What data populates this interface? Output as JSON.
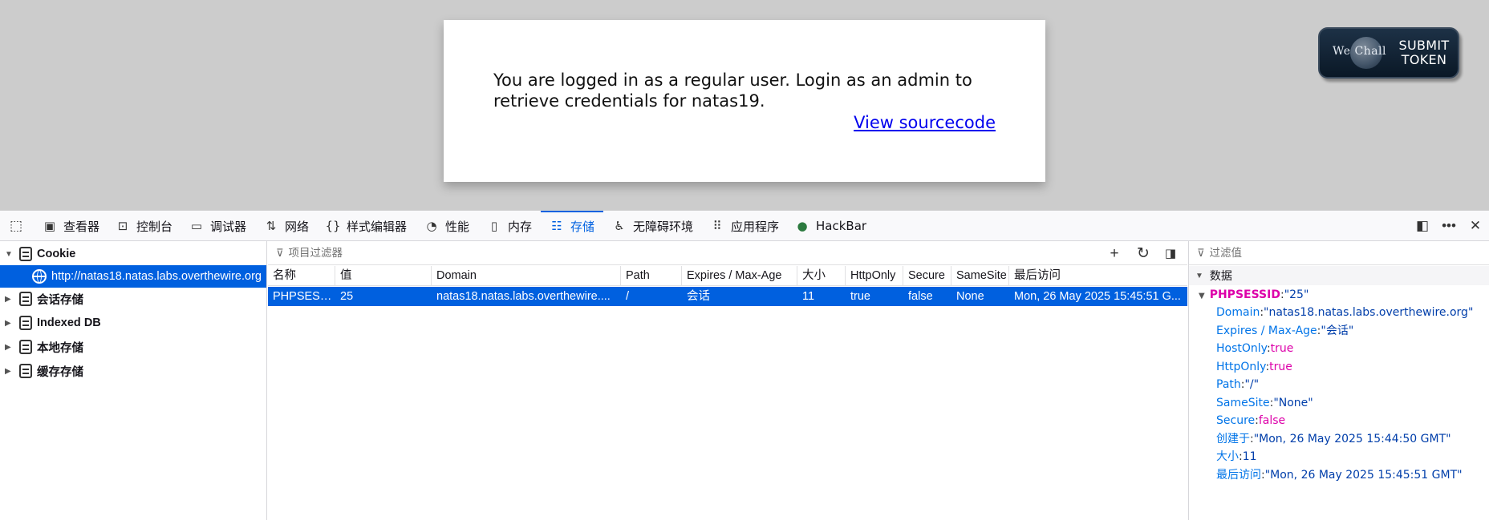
{
  "page": {
    "message": "You are logged in as a regular user. Login as an admin to retrieve credentials for natas19.",
    "source_link": "View sourcecode",
    "wechall_logo": "We Chall",
    "wechall_submit": "SUBMIT",
    "wechall_token": "TOKEN"
  },
  "toolbar": {
    "tabs": [
      {
        "label": "查看器",
        "icon": "inspector-icon"
      },
      {
        "label": "控制台",
        "icon": "console-icon"
      },
      {
        "label": "调试器",
        "icon": "debugger-icon"
      },
      {
        "label": "网络",
        "icon": "network-icon"
      },
      {
        "label": "样式编辑器",
        "icon": "style-editor-icon"
      },
      {
        "label": "性能",
        "icon": "performance-icon"
      },
      {
        "label": "内存",
        "icon": "memory-icon"
      },
      {
        "label": "存储",
        "icon": "storage-icon"
      },
      {
        "label": "无障碍环境",
        "icon": "accessibility-icon"
      },
      {
        "label": "应用程序",
        "icon": "application-icon"
      },
      {
        "label": "HackBar",
        "icon": "hackbar-icon"
      }
    ],
    "active_tab": "存储"
  },
  "sidebar": {
    "items": [
      {
        "label": "Cookie",
        "expanded": true
      },
      {
        "label": "http://natas18.natas.labs.overthewire.org",
        "selected": true
      },
      {
        "label": "会话存储"
      },
      {
        "label": "Indexed DB"
      },
      {
        "label": "本地存储"
      },
      {
        "label": "缓存存储"
      }
    ]
  },
  "table": {
    "filter_placeholder": "项目过滤器",
    "columns": [
      "名称",
      "值",
      "Domain",
      "Path",
      "Expires / Max-Age",
      "大小",
      "HttpOnly",
      "Secure",
      "SameSite",
      "最后访问"
    ],
    "rows": [
      [
        "PHPSESS...",
        "25",
        "natas18.natas.labs.overthewire....",
        "/",
        "会话",
        "11",
        "true",
        "false",
        "None",
        "Mon, 26 May 2025 15:45:51 G..."
      ]
    ]
  },
  "details": {
    "filter_placeholder": "过滤值",
    "section": "数据",
    "root_key": "PHPSESSID",
    "root_value": "\"25\"",
    "fields": [
      {
        "key": "Domain",
        "value": "\"natas18.natas.labs.overthewire.org\"",
        "type": "str"
      },
      {
        "key": "Expires / Max-Age",
        "value": "\"会话\"",
        "type": "str"
      },
      {
        "key": "HostOnly",
        "value": "true",
        "type": "bool"
      },
      {
        "key": "HttpOnly",
        "value": "true",
        "type": "bool"
      },
      {
        "key": "Path",
        "value": "\"/\"",
        "type": "str"
      },
      {
        "key": "SameSite",
        "value": "\"None\"",
        "type": "str"
      },
      {
        "key": "Secure",
        "value": "false",
        "type": "bool"
      },
      {
        "key": "创建于",
        "value": "\"Mon, 26 May 2025 15:44:50 GMT\"",
        "type": "str"
      },
      {
        "key": "大小",
        "value": "11",
        "type": "num"
      },
      {
        "key": "最后访问",
        "value": "\"Mon, 26 May 2025 15:45:51 GMT\"",
        "type": "str"
      }
    ]
  }
}
